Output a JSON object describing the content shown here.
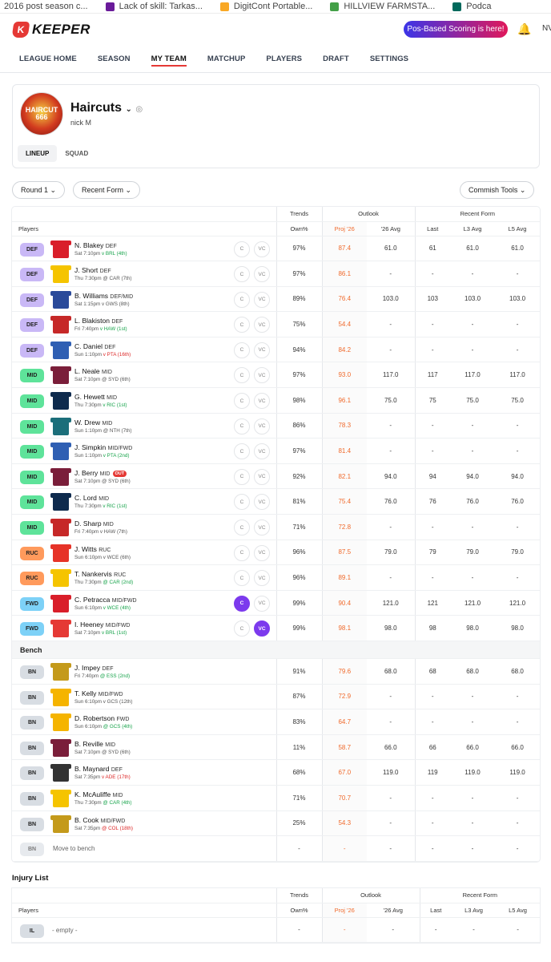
{
  "bookmarks": [
    {
      "label": "2016 post season c...",
      "color": "#2e7d32"
    },
    {
      "label": "Lack of skill: Tarkas...",
      "color": "#6a1b9a"
    },
    {
      "label": "DigitCont Portable...",
      "color": "#f9a825"
    },
    {
      "label": "HILLVIEW FARMSTA...",
      "color": "#43a047"
    },
    {
      "label": "Podca",
      "color": "#00695c"
    }
  ],
  "header": {
    "logo_text": "KEEPER",
    "logo_mark": "K",
    "promo": "Pos-Based Scoring is here!",
    "user_initials": "NV"
  },
  "nav": [
    "LEAGUE HOME",
    "SEASON",
    "MY TEAM",
    "MATCHUP",
    "PLAYERS",
    "DRAFT",
    "SETTINGS"
  ],
  "team": {
    "name": "Haircuts",
    "owner": "nick M",
    "badge_text": "HAIRCUT 666",
    "tabs": [
      "LINEUP",
      "SQUAD"
    ]
  },
  "controls": {
    "round": "Round 1",
    "form": "Recent Form",
    "tools": "Commish Tools"
  },
  "table_headers": {
    "groups": [
      "Trends",
      "Outlook",
      "Recent Form"
    ],
    "cols": [
      "Players",
      "Own%",
      "Proj '26",
      "'26 Avg",
      "Last",
      "L3 Avg",
      "L5 Avg"
    ]
  },
  "players": [
    {
      "pos": "DEF",
      "name": "N. Blakey",
      "ppos": "DEF",
      "meta": "Sat 7:10pm",
      "opp": "v BRL (4th)",
      "oc": "gd",
      "jc": "#d91e2a",
      "own": "97%",
      "proj": "87.4",
      "avg": "61.0",
      "last": "61",
      "l3": "61.0",
      "l5": "61.0",
      "cap": ""
    },
    {
      "pos": "DEF",
      "name": "J. Short",
      "ppos": "DEF",
      "meta": "Thu 7:30pm",
      "opp": "@ CAR (7th)",
      "oc": "",
      "jc": "#f5c400",
      "own": "97%",
      "proj": "86.1",
      "avg": "-",
      "last": "-",
      "l3": "-",
      "l5": "-",
      "cap": ""
    },
    {
      "pos": "DEF",
      "name": "B. Williams",
      "ppos": "DEF/MID",
      "meta": "Sat 1:15pm",
      "opp": "v GWS (8th)",
      "oc": "",
      "jc": "#2a4a9a",
      "own": "89%",
      "proj": "76.4",
      "avg": "103.0",
      "last": "103",
      "l3": "103.0",
      "l5": "103.0",
      "cap": ""
    },
    {
      "pos": "DEF",
      "name": "L. Blakiston",
      "ppos": "DEF",
      "meta": "Fri 7:40pm",
      "opp": "v HAW (1st)",
      "oc": "gd",
      "jc": "#c62828",
      "own": "75%",
      "proj": "54.4",
      "avg": "-",
      "last": "-",
      "l3": "-",
      "l5": "-",
      "cap": ""
    },
    {
      "pos": "DEF",
      "name": "C. Daniel",
      "ppos": "DEF",
      "meta": "Sun 1:10pm",
      "opp": "v PTA (16th)",
      "oc": "bd",
      "jc": "#2f5fb3",
      "own": "94%",
      "proj": "84.2",
      "avg": "-",
      "last": "-",
      "l3": "-",
      "l5": "-",
      "cap": ""
    },
    {
      "pos": "MID",
      "name": "L. Neale",
      "ppos": "MID",
      "meta": "Sat 7:10pm",
      "opp": "@ SYD (6th)",
      "oc": "",
      "jc": "#7a1e3a",
      "own": "97%",
      "proj": "93.0",
      "avg": "117.0",
      "last": "117",
      "l3": "117.0",
      "l5": "117.0",
      "cap": ""
    },
    {
      "pos": "MID",
      "name": "G. Hewett",
      "ppos": "MID",
      "meta": "Thu 7:30pm",
      "opp": "v RIC (1st)",
      "oc": "gd",
      "jc": "#0e2a4d",
      "own": "98%",
      "proj": "96.1",
      "avg": "75.0",
      "last": "75",
      "l3": "75.0",
      "l5": "75.0",
      "cap": ""
    },
    {
      "pos": "MID",
      "name": "W. Drew",
      "ppos": "MID",
      "meta": "Sun 1:10pm",
      "opp": "@ NTH (7th)",
      "oc": "",
      "jc": "#1b6e7a",
      "own": "86%",
      "proj": "78.3",
      "avg": "-",
      "last": "-",
      "l3": "-",
      "l5": "-",
      "cap": ""
    },
    {
      "pos": "MID",
      "name": "J. Simpkin",
      "ppos": "MID/FWD",
      "meta": "Sun 1:10pm",
      "opp": "v PTA (2nd)",
      "oc": "gd",
      "jc": "#2f5fb3",
      "own": "97%",
      "proj": "81.4",
      "avg": "-",
      "last": "-",
      "l3": "-",
      "l5": "-",
      "cap": ""
    },
    {
      "pos": "MID",
      "name": "J. Berry",
      "ppos": "MID",
      "meta": "Sat 7:10pm",
      "opp": "@ SYD (6th)",
      "oc": "",
      "jc": "#7a1e3a",
      "own": "92%",
      "proj": "82.1",
      "avg": "94.0",
      "last": "94",
      "l3": "94.0",
      "l5": "94.0",
      "cap": "",
      "out": "OUT"
    },
    {
      "pos": "MID",
      "name": "C. Lord",
      "ppos": "MID",
      "meta": "Thu 7:30pm",
      "opp": "v RIC (1st)",
      "oc": "gd",
      "jc": "#0e2a4d",
      "own": "81%",
      "proj": "75.4",
      "avg": "76.0",
      "last": "76",
      "l3": "76.0",
      "l5": "76.0",
      "cap": ""
    },
    {
      "pos": "MID",
      "name": "D. Sharp",
      "ppos": "MID",
      "meta": "Fri 7:40pm",
      "opp": "v HAW (7th)",
      "oc": "",
      "jc": "#c62828",
      "own": "71%",
      "proj": "72.8",
      "avg": "-",
      "last": "-",
      "l3": "-",
      "l5": "-",
      "cap": ""
    },
    {
      "pos": "RUC",
      "name": "J. Witts",
      "ppos": "RUC",
      "meta": "Sun 6:10pm",
      "opp": "v WCE (6th)",
      "oc": "",
      "jc": "#e63328",
      "own": "96%",
      "proj": "87.5",
      "avg": "79.0",
      "last": "79",
      "l3": "79.0",
      "l5": "79.0",
      "cap": ""
    },
    {
      "pos": "RUC",
      "name": "T. Nankervis",
      "ppos": "RUC",
      "meta": "Thu 7:30pm",
      "opp": "@ CAR (2nd)",
      "oc": "gd",
      "jc": "#f5c400",
      "own": "96%",
      "proj": "89.1",
      "avg": "-",
      "last": "-",
      "l3": "-",
      "l5": "-",
      "cap": ""
    },
    {
      "pos": "FWD",
      "name": "C. Petracca",
      "ppos": "MID/FWD",
      "meta": "Sun 6:10pm",
      "opp": "v WCE (4th)",
      "oc": "gd",
      "jc": "#d91e2a",
      "own": "99%",
      "proj": "90.4",
      "avg": "121.0",
      "last": "121",
      "l3": "121.0",
      "l5": "121.0",
      "cap": "C"
    },
    {
      "pos": "FWD",
      "name": "I. Heeney",
      "ppos": "MID/FWD",
      "meta": "Sat 7:10pm",
      "opp": "v BRL (1st)",
      "oc": "gd",
      "jc": "#e53935",
      "own": "99%",
      "proj": "98.1",
      "avg": "98.0",
      "last": "98",
      "l3": "98.0",
      "l5": "98.0",
      "cap": "VC"
    }
  ],
  "bench_label": "Bench",
  "bench": [
    {
      "pos": "BN",
      "name": "J. Impey",
      "ppos": "DEF",
      "meta": "Fri 7:40pm",
      "opp": "@ ESS (2nd)",
      "oc": "gd",
      "jc": "#c49a1b",
      "own": "91%",
      "proj": "79.6",
      "avg": "68.0",
      "last": "68",
      "l3": "68.0",
      "l5": "68.0"
    },
    {
      "pos": "BN",
      "name": "T. Kelly",
      "ppos": "MID/FWD",
      "meta": "Sun 6:10pm",
      "opp": "v GCS (12th)",
      "oc": "",
      "jc": "#f5b400",
      "own": "87%",
      "proj": "72.9",
      "avg": "-",
      "last": "-",
      "l3": "-",
      "l5": "-"
    },
    {
      "pos": "BN",
      "name": "D. Robertson",
      "ppos": "FWD",
      "meta": "Sun 6:10pm",
      "opp": "@ GCS (4th)",
      "oc": "gd",
      "jc": "#f5b400",
      "own": "83%",
      "proj": "64.7",
      "avg": "-",
      "last": "-",
      "l3": "-",
      "l5": "-"
    },
    {
      "pos": "BN",
      "name": "B. Reville",
      "ppos": "MID",
      "meta": "Sat 7:10pm",
      "opp": "@ SYD (6th)",
      "oc": "",
      "jc": "#7a1e3a",
      "own": "11%",
      "proj": "58.7",
      "avg": "66.0",
      "last": "66",
      "l3": "66.0",
      "l5": "66.0"
    },
    {
      "pos": "BN",
      "name": "B. Maynard",
      "ppos": "DEF",
      "meta": "Sat 7:35pm",
      "opp": "v ADE (17th)",
      "oc": "bd",
      "jc": "#333333",
      "own": "68%",
      "proj": "67.0",
      "avg": "119.0",
      "last": "119",
      "l3": "119.0",
      "l5": "119.0"
    },
    {
      "pos": "BN",
      "name": "K. McAuliffe",
      "ppos": "MID",
      "meta": "Thu 7:30pm",
      "opp": "@ CAR (4th)",
      "oc": "gd",
      "jc": "#f5c400",
      "own": "71%",
      "proj": "70.7",
      "avg": "-",
      "last": "-",
      "l3": "-",
      "l5": "-"
    },
    {
      "pos": "BN",
      "name": "B. Cook",
      "ppos": "MID/FWD",
      "meta": "Sat 7:35pm",
      "opp": "@ COL (18th)",
      "oc": "bd",
      "jc": "#c49a1b",
      "own": "25%",
      "proj": "54.3",
      "avg": "-",
      "last": "-",
      "l3": "-",
      "l5": "-"
    }
  ],
  "move_to_bench": {
    "pos": "BN",
    "label": "Move to bench"
  },
  "injury": {
    "title": "Injury List",
    "pos": "IL",
    "empty": "- empty -"
  },
  "cap_labels": {
    "c": "C",
    "vc": "VC"
  },
  "dash": "-"
}
